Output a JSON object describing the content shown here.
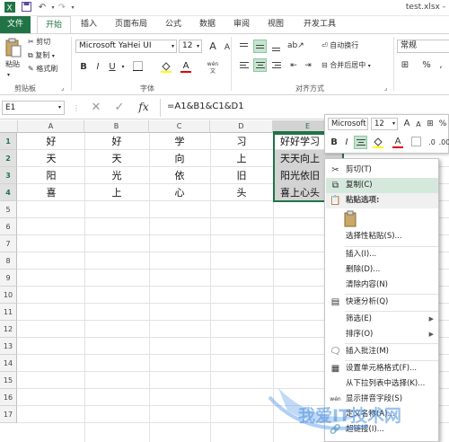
{
  "title_bar": {
    "filename": "test.xlsx -"
  },
  "tabs": [
    "文件",
    "开始",
    "插入",
    "页面布局",
    "公式",
    "数据",
    "审阅",
    "视图",
    "开发工具"
  ],
  "ribbon": {
    "clipboard": {
      "paste": "粘贴",
      "cut": "剪切",
      "copy": "复制",
      "format_painter": "格式刷",
      "group": "剪贴板"
    },
    "font": {
      "name": "Microsoft YaHei UI",
      "size": "12",
      "bold": "B",
      "italic": "I",
      "underline": "U",
      "wen": "wén",
      "group": "字体"
    },
    "alignment": {
      "wrap_text": "自动换行",
      "merge_center": "合并后居中",
      "group": "对齐方式"
    },
    "number": {
      "format": "常规",
      "percent": "%",
      "comma": ","
    }
  },
  "formula_bar": {
    "name_box": "E1",
    "formula": "=A1&B1&C1&D1",
    "fx": "fx"
  },
  "sheet": {
    "columns": [
      "A",
      "B",
      "C",
      "D",
      "E"
    ],
    "rows": [
      "1",
      "2",
      "3",
      "4",
      "5",
      "6",
      "7",
      "8",
      "9",
      "10",
      "11",
      "12",
      "13",
      "14",
      "15",
      "16",
      "17"
    ],
    "cells": [
      [
        "好",
        "好",
        "学",
        "习",
        "好好学习"
      ],
      [
        "天",
        "天",
        "向",
        "上",
        "天天向上"
      ],
      [
        "阳",
        "光",
        "依",
        "旧",
        "阳光依旧"
      ],
      [
        "喜",
        "上",
        "心",
        "头",
        "喜上心头"
      ]
    ]
  },
  "mini_toolbar": {
    "font": "Microsoft",
    "size": "12",
    "bold": "B",
    "italic": "I"
  },
  "context_menu": {
    "items": [
      "剪切(T)",
      "复制(C)",
      "粘贴选项:",
      "选择性粘贴(S)...",
      "插入(I)...",
      "删除(D)...",
      "清除内容(N)",
      "快速分析(Q)",
      "筛选(E)",
      "排序(O)",
      "插入批注(M)",
      "设置单元格格式(F)...",
      "从下拉列表中选择(K)...",
      "显示拼音字段(S)",
      "定义名称(A)...",
      "超链接(I)..."
    ]
  },
  "watermark": {
    "text": "我爱IT技术网"
  },
  "colors": {
    "excel_green": "#217346",
    "selection_gray": "#d3d3d3",
    "highlight": "#d5e8dc"
  }
}
